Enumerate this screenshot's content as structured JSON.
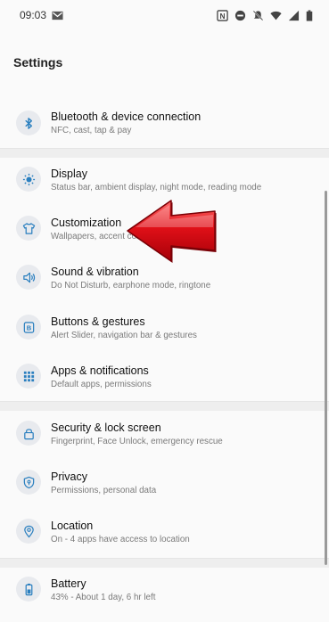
{
  "status_bar": {
    "time": "09:03",
    "icons": [
      "gmail-icon",
      "nfc-icon",
      "dnd-icon",
      "bell-muted-icon",
      "wifi-icon",
      "signal-icon",
      "battery-icon"
    ]
  },
  "page": {
    "title": "Settings"
  },
  "items": [
    {
      "title": "Bluetooth & device connection",
      "subtitle": "NFC, cast, tap & pay",
      "icon": "bluetooth-icon"
    },
    {
      "title": "Display",
      "subtitle": "Status bar, ambient display, night mode, reading mode",
      "icon": "brightness-icon"
    },
    {
      "title": "Customization",
      "subtitle": "Wallpapers, accent colo",
      "icon": "tshirt-icon"
    },
    {
      "title": "Sound & vibration",
      "subtitle": "Do Not Disturb, earphone mode, ringtone",
      "icon": "speaker-icon"
    },
    {
      "title": "Buttons & gestures",
      "subtitle": "Alert Slider, navigation bar & gestures",
      "icon": "buttons-icon"
    },
    {
      "title": "Apps & notifications",
      "subtitle": "Default apps, permissions",
      "icon": "apps-grid-icon"
    },
    {
      "title": "Security & lock screen",
      "subtitle": "Fingerprint, Face Unlock, emergency rescue",
      "icon": "lock-icon"
    },
    {
      "title": "Privacy",
      "subtitle": "Permissions, personal data",
      "icon": "privacy-shield-icon"
    },
    {
      "title": "Location",
      "subtitle": "On - 4 apps have access to location",
      "icon": "location-pin-icon"
    },
    {
      "title": "Battery",
      "subtitle": "43% - About 1 day, 6 hr left",
      "icon": "battery-settings-icon"
    }
  ],
  "colors": {
    "accent": "#2a7fbf",
    "arrow": "#d0131b",
    "divider": "#eeeeee",
    "background": "#fafafa"
  }
}
